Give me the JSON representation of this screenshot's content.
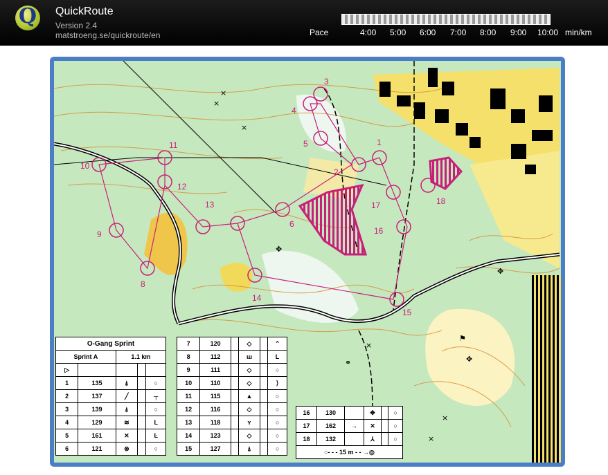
{
  "app": {
    "name": "QuickRoute",
    "version": "Version 2.4",
    "url": "matstroeng.se/quickroute/en"
  },
  "pace": {
    "label": "Pace",
    "ticks": [
      "4:00",
      "5:00",
      "6:00",
      "7:00",
      "8:00",
      "9:00",
      "10:00"
    ],
    "unit": "min/km"
  },
  "course": {
    "title": "O-Gang Sprint",
    "class": "Sprint A",
    "length": "1.1 km",
    "controls": [
      {
        "n": "1",
        "code": "135"
      },
      {
        "n": "2",
        "code": "137"
      },
      {
        "n": "3",
        "code": "139"
      },
      {
        "n": "4",
        "code": "129"
      },
      {
        "n": "5",
        "code": "161"
      },
      {
        "n": "6",
        "code": "121"
      },
      {
        "n": "7",
        "code": "120"
      },
      {
        "n": "8",
        "code": "112"
      },
      {
        "n": "9",
        "code": "111"
      },
      {
        "n": "10",
        "code": "110"
      },
      {
        "n": "11",
        "code": "115"
      },
      {
        "n": "12",
        "code": "116"
      },
      {
        "n": "13",
        "code": "118"
      },
      {
        "n": "14",
        "code": "123"
      },
      {
        "n": "15",
        "code": "127"
      },
      {
        "n": "16",
        "code": "130"
      },
      {
        "n": "17",
        "code": "162"
      },
      {
        "n": "18",
        "code": "132"
      }
    ],
    "finish": "15 m"
  },
  "map_labels": [
    "1",
    "2",
    "3",
    "4",
    "5",
    "6",
    "8",
    "9",
    "10",
    "11",
    "12",
    "13",
    "14",
    "15",
    "16",
    "17",
    "18"
  ],
  "colors": {
    "course": "#c8207a",
    "forest": "#8fd19a",
    "open": "#f6e27a",
    "contour": "#d88a2a",
    "water": "#4a7fc8"
  }
}
